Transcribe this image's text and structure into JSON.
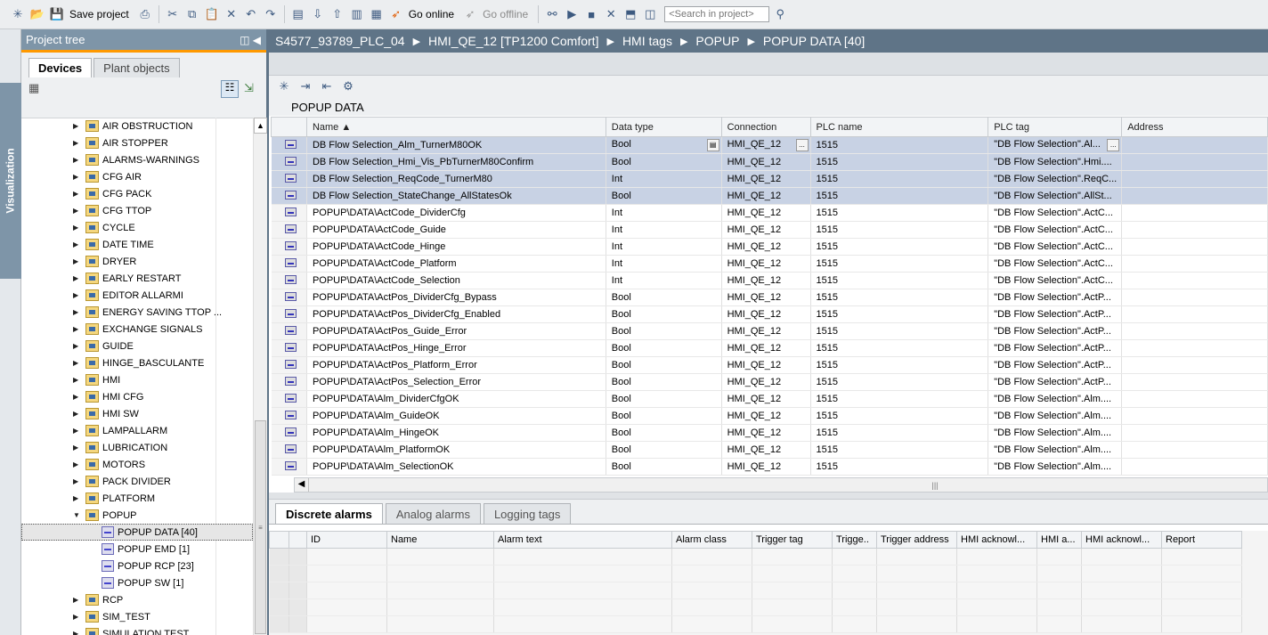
{
  "toolbar": {
    "save_label": "Save project",
    "go_online_label": "Go online",
    "go_offline_label": "Go offline",
    "search_placeholder": "<Search in project>"
  },
  "left_sidebar": {
    "tab_label": "Visualization"
  },
  "project_tree": {
    "title": "Project tree",
    "tabs": [
      "Devices",
      "Plant objects"
    ],
    "folders": [
      "AIR OBSTRUCTION",
      "AIR STOPPER",
      "ALARMS-WARNINGS",
      "CFG AIR",
      "CFG PACK",
      "CFG TTOP",
      "CYCLE",
      "DATE TIME",
      "DRYER",
      "EARLY RESTART",
      "EDITOR ALLARMI",
      "ENERGY SAVING TTOP ...",
      "EXCHANGE SIGNALS",
      "GUIDE",
      "HINGE_BASCULANTE",
      "HMI",
      "HMI CFG",
      "HMI SW",
      "LAMPALLARM",
      "LUBRICATION",
      "MOTORS",
      "PACK DIVIDER",
      "PLATFORM",
      "POPUP"
    ],
    "popup_children": [
      "POPUP DATA [40]",
      "POPUP EMD [1]",
      "POPUP RCP [23]",
      "POPUP SW [1]"
    ],
    "after_folders": [
      "RCP",
      "SIM_TEST",
      "SIMULATION TEST"
    ],
    "selected": "POPUP DATA [40]"
  },
  "breadcrumb": [
    "S4577_93789_PLC_04",
    "HMI_QE_12 [TP1200 Comfort]",
    "HMI tags",
    "POPUP",
    "POPUP DATA [40]"
  ],
  "editor": {
    "title": "POPUP DATA",
    "columns": [
      "Name",
      "Data type",
      "Connection",
      "PLC name",
      "PLC tag",
      "Address"
    ],
    "rows": [
      {
        "name": "DB Flow Selection_Alm_TurnerM80OK",
        "type": "Bool",
        "conn": "HMI_QE_12",
        "plc": "1515",
        "tag": "\"DB Flow Selection\".Al...",
        "addr": "",
        "sel": true
      },
      {
        "name": "DB Flow Selection_Hmi_Vis_PbTurnerM80Confirm",
        "type": "Bool",
        "conn": "HMI_QE_12",
        "plc": "1515",
        "tag": "\"DB Flow Selection\".Hmi....",
        "addr": "",
        "sel": true
      },
      {
        "name": "DB Flow Selection_ReqCode_TurnerM80",
        "type": "Int",
        "conn": "HMI_QE_12",
        "plc": "1515",
        "tag": "\"DB Flow Selection\".ReqC...",
        "addr": "",
        "sel": true
      },
      {
        "name": "DB Flow Selection_StateChange_AllStatesOk",
        "type": "Bool",
        "conn": "HMI_QE_12",
        "plc": "1515",
        "tag": "\"DB Flow Selection\".AllSt...",
        "addr": "",
        "sel": true
      },
      {
        "name": "POPUP\\DATA\\ActCode_DividerCfg",
        "type": "Int",
        "conn": "HMI_QE_12",
        "plc": "1515",
        "tag": "\"DB Flow Selection\".ActC...",
        "addr": ""
      },
      {
        "name": "POPUP\\DATA\\ActCode_Guide",
        "type": "Int",
        "conn": "HMI_QE_12",
        "plc": "1515",
        "tag": "\"DB Flow Selection\".ActC...",
        "addr": ""
      },
      {
        "name": "POPUP\\DATA\\ActCode_Hinge",
        "type": "Int",
        "conn": "HMI_QE_12",
        "plc": "1515",
        "tag": "\"DB Flow Selection\".ActC...",
        "addr": ""
      },
      {
        "name": "POPUP\\DATA\\ActCode_Platform",
        "type": "Int",
        "conn": "HMI_QE_12",
        "plc": "1515",
        "tag": "\"DB Flow Selection\".ActC...",
        "addr": ""
      },
      {
        "name": "POPUP\\DATA\\ActCode_Selection",
        "type": "Int",
        "conn": "HMI_QE_12",
        "plc": "1515",
        "tag": "\"DB Flow Selection\".ActC...",
        "addr": ""
      },
      {
        "name": "POPUP\\DATA\\ActPos_DividerCfg_Bypass",
        "type": "Bool",
        "conn": "HMI_QE_12",
        "plc": "1515",
        "tag": "\"DB Flow Selection\".ActP...",
        "addr": ""
      },
      {
        "name": "POPUP\\DATA\\ActPos_DividerCfg_Enabled",
        "type": "Bool",
        "conn": "HMI_QE_12",
        "plc": "1515",
        "tag": "\"DB Flow Selection\".ActP...",
        "addr": ""
      },
      {
        "name": "POPUP\\DATA\\ActPos_Guide_Error",
        "type": "Bool",
        "conn": "HMI_QE_12",
        "plc": "1515",
        "tag": "\"DB Flow Selection\".ActP...",
        "addr": ""
      },
      {
        "name": "POPUP\\DATA\\ActPos_Hinge_Error",
        "type": "Bool",
        "conn": "HMI_QE_12",
        "plc": "1515",
        "tag": "\"DB Flow Selection\".ActP...",
        "addr": ""
      },
      {
        "name": "POPUP\\DATA\\ActPos_Platform_Error",
        "type": "Bool",
        "conn": "HMI_QE_12",
        "plc": "1515",
        "tag": "\"DB Flow Selection\".ActP...",
        "addr": ""
      },
      {
        "name": "POPUP\\DATA\\ActPos_Selection_Error",
        "type": "Bool",
        "conn": "HMI_QE_12",
        "plc": "1515",
        "tag": "\"DB Flow Selection\".ActP...",
        "addr": ""
      },
      {
        "name": "POPUP\\DATA\\Alm_DividerCfgOK",
        "type": "Bool",
        "conn": "HMI_QE_12",
        "plc": "1515",
        "tag": "\"DB Flow Selection\".Alm....",
        "addr": ""
      },
      {
        "name": "POPUP\\DATA\\Alm_GuideOK",
        "type": "Bool",
        "conn": "HMI_QE_12",
        "plc": "1515",
        "tag": "\"DB Flow Selection\".Alm....",
        "addr": ""
      },
      {
        "name": "POPUP\\DATA\\Alm_HingeOK",
        "type": "Bool",
        "conn": "HMI_QE_12",
        "plc": "1515",
        "tag": "\"DB Flow Selection\".Alm....",
        "addr": ""
      },
      {
        "name": "POPUP\\DATA\\Alm_PlatformOK",
        "type": "Bool",
        "conn": "HMI_QE_12",
        "plc": "1515",
        "tag": "\"DB Flow Selection\".Alm....",
        "addr": ""
      },
      {
        "name": "POPUP\\DATA\\Alm_SelectionOK",
        "type": "Bool",
        "conn": "HMI_QE_12",
        "plc": "1515",
        "tag": "\"DB Flow Selection\".Alm....",
        "addr": ""
      }
    ]
  },
  "bottom": {
    "tabs": [
      "Discrete alarms",
      "Analog alarms",
      "Logging tags"
    ],
    "alarm_columns": [
      "ID",
      "Name",
      "Alarm text",
      "Alarm class",
      "Trigger tag",
      "Trigge..",
      "Trigger address",
      "HMI acknowl...",
      "HMI a...",
      "HMI acknowl...",
      "Report"
    ]
  },
  "colors": {
    "header_blue": "#5f7487",
    "tree_head": "#7e95a8",
    "accent_orange": "#ff9900",
    "selected_row": "#c8d2e4"
  }
}
